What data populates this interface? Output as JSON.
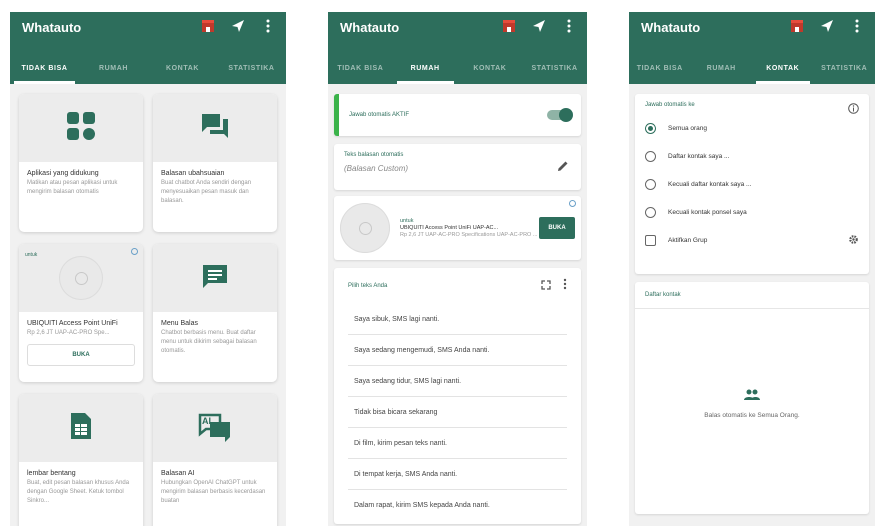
{
  "app": {
    "title": "Whatauto"
  },
  "tabs": [
    "TIDAK BISA",
    "RUMAH",
    "KONTAK",
    "STATISTIKA"
  ],
  "colors": {
    "primary": "#2d6e5c",
    "active_bar": "#3bb34a"
  },
  "screen1": {
    "cards": [
      {
        "icon": "apps-grid-icon",
        "name": "Aplikasi yang didukung",
        "desc": "Matikan atau pesan aplikasi untuk mengirim balasan otomatis"
      },
      {
        "icon": "chat-bubbles-icon",
        "name": "Balasan ubahsuaian",
        "desc": "Buat chatbot Anda sendiri dengan menyesuaikan pesan masuk dan balasan."
      },
      {
        "ad_tag": "untuk",
        "name": "UBIQUITI Access Point UniFi",
        "desc": "Rp 2,6 JT UAP-AC-PRO Spe...",
        "button": "BUKA"
      },
      {
        "icon": "menu-message-icon",
        "name": "Menu Balas",
        "desc": "Chatbot berbasis menu. Buat daftar menu untuk dikirim sebagai balasan otomatis."
      },
      {
        "icon": "spreadsheet-icon",
        "name": "lembar bentang",
        "desc": "Buat, edit pesan balasan khusus Anda dengan Google Sheet. Ketuk tombol Sinkro..."
      },
      {
        "icon": "ai-chat-icon",
        "icon_text": "AI",
        "name": "Balasan AI",
        "desc": "Hubungkan OpenAI ChatGPT untuk mengirim balasan berbasis kecerdasan buatan"
      }
    ]
  },
  "screen2": {
    "auto_label": "Jawab otomatis AKTIF",
    "reply_heading": "Teks balasan otomatis",
    "reply_value": "(Balasan Custom)",
    "ad": {
      "tag": "untuk",
      "line1": "UBIQUITI Access Point UniFi UAP-AC...",
      "line2": "Rp 2,6 JT UAP-AC-PRO Specifications UAP-AC-PRO ...",
      "button": "BUKA"
    },
    "list_heading": "Pilih teks Anda",
    "messages": [
      "Saya sibuk, SMS lagi nanti.",
      "Saya sedang mengemudi, SMS Anda nanti.",
      "Saya sedang tidur, SMS lagi nanti.",
      "Tidak bisa bicara sekarang",
      "Di film, kirim pesan teks nanti.",
      "Di tempat kerja, SMS Anda nanti.",
      "Dalam rapat, kirim SMS kepada Anda nanti."
    ]
  },
  "screen3": {
    "heading": "Jawab otomatis ke",
    "options": [
      "Semua orang",
      "Daftar kontak saya ...",
      "Kecuali daftar kontak saya ...",
      "Kecuali kontak ponsel saya"
    ],
    "selected": 0,
    "group_label": "Aktifkan Grup",
    "contacts_heading": "Daftar kontak",
    "empty_text": "Balas otomatis ke Semua Orang."
  }
}
